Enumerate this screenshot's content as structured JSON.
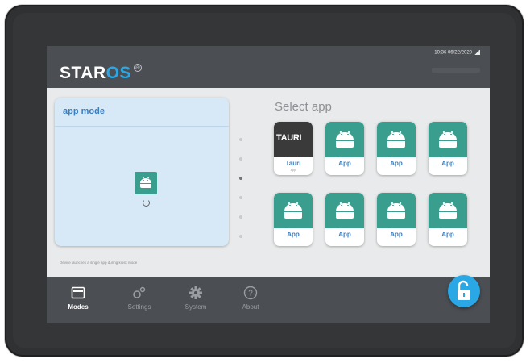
{
  "header": {
    "logo_prefix": "STAR",
    "logo_suffix": "OS",
    "registered_mark": "®",
    "status_text": "10:36 06/22/2020"
  },
  "mode_card": {
    "title": "app mode"
  },
  "caption": "Device launches a single app during kiosk mode",
  "select": {
    "title": "Select app",
    "apps": [
      {
        "label": "Tauri",
        "sub": "app",
        "logo_text": "TAURI",
        "icon": "tauri-logo"
      },
      {
        "label": "App",
        "icon": "android-icon"
      },
      {
        "label": "App",
        "icon": "android-icon"
      },
      {
        "label": "App",
        "icon": "android-icon"
      },
      {
        "label": "App",
        "icon": "android-icon"
      },
      {
        "label": "App",
        "icon": "android-icon"
      },
      {
        "label": "App",
        "icon": "android-icon"
      },
      {
        "label": "App",
        "icon": "android-icon"
      }
    ]
  },
  "pager": {
    "count": 6,
    "active_index": 2
  },
  "nav": [
    {
      "label": "Modes",
      "icon": "modes-icon",
      "active": true
    },
    {
      "label": "Settings",
      "icon": "settings-icon",
      "active": false
    },
    {
      "label": "System",
      "icon": "gear-icon",
      "active": false
    },
    {
      "label": "About",
      "icon": "info-icon",
      "active": false
    }
  ],
  "lock_button": {
    "icon": "unlock-icon"
  },
  "colors": {
    "accent": "#2aa8e6",
    "app_tile": "#3a9e8f",
    "label_blue": "#3c7ec0"
  }
}
